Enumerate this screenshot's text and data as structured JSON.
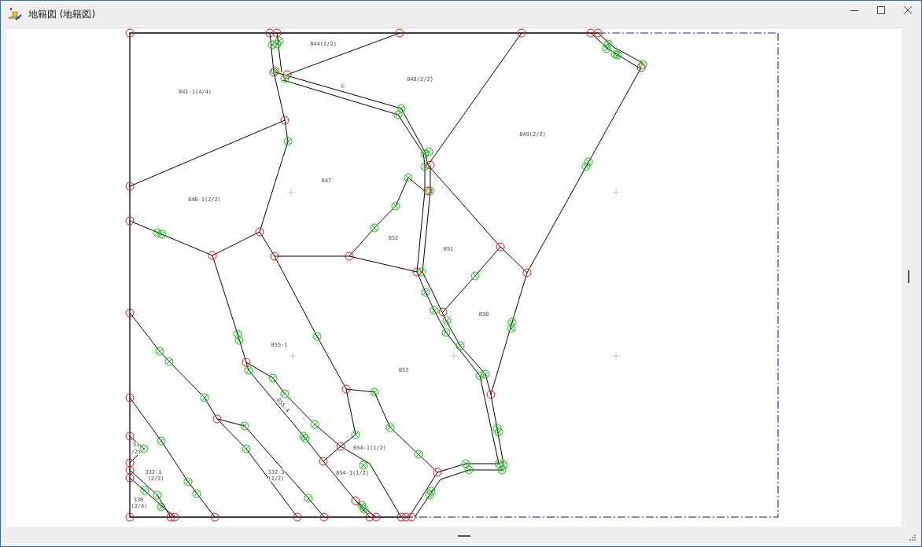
{
  "window": {
    "title": "地籍図 (地籍図)"
  },
  "map": {
    "labels": [
      {
        "text": "844(2/2)"
      },
      {
        "text": "848(2/2)"
      },
      {
        "text": "841-1(4/4)"
      },
      {
        "text": "①"
      },
      {
        "text": "849(2/2)"
      },
      {
        "text": "847"
      },
      {
        "text": "846-1(2/2)"
      },
      {
        "text": "852"
      },
      {
        "text": "851"
      },
      {
        "text": "850"
      },
      {
        "text": "855-1"
      },
      {
        "text": "853"
      },
      {
        "text": "855-4"
      },
      {
        "text": "31"
      },
      {
        "text": "854-1(1/2)"
      },
      {
        "text": "/2)"
      },
      {
        "text": "332-1"
      },
      {
        "text": "332-3"
      },
      {
        "text": "854-3(1/2)"
      },
      {
        "text": "(2/3)"
      },
      {
        "text": "(1/2)"
      },
      {
        "text": "330"
      },
      {
        "text": "(2/4)"
      }
    ]
  }
}
